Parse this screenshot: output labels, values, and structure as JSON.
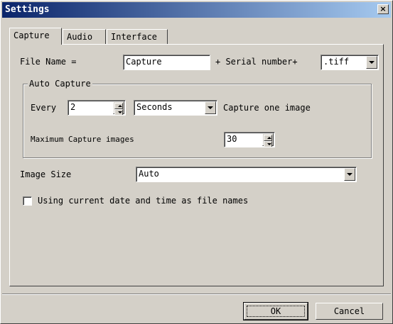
{
  "window": {
    "title": "Settings",
    "close_label": "×"
  },
  "tabs": [
    {
      "label": "Capture",
      "active": true
    },
    {
      "label": "Audio",
      "active": false
    },
    {
      "label": "Interface",
      "active": false
    }
  ],
  "filename": {
    "label": "File Name =",
    "value": "Capture",
    "serial_label": "+ Serial number+",
    "extension": ".tiff"
  },
  "auto_capture": {
    "group_label": "Auto Capture",
    "every_label": "Every",
    "every_value": "2",
    "unit": "Seconds",
    "capture_text": "Capture one image",
    "max_label": "Maximum Capture images",
    "max_value": "30"
  },
  "image_size": {
    "label": "Image Size",
    "value": "Auto"
  },
  "date_option": {
    "label": "Using current date and time as file names",
    "checked": false
  },
  "buttons": {
    "ok": "OK",
    "cancel": "Cancel"
  }
}
